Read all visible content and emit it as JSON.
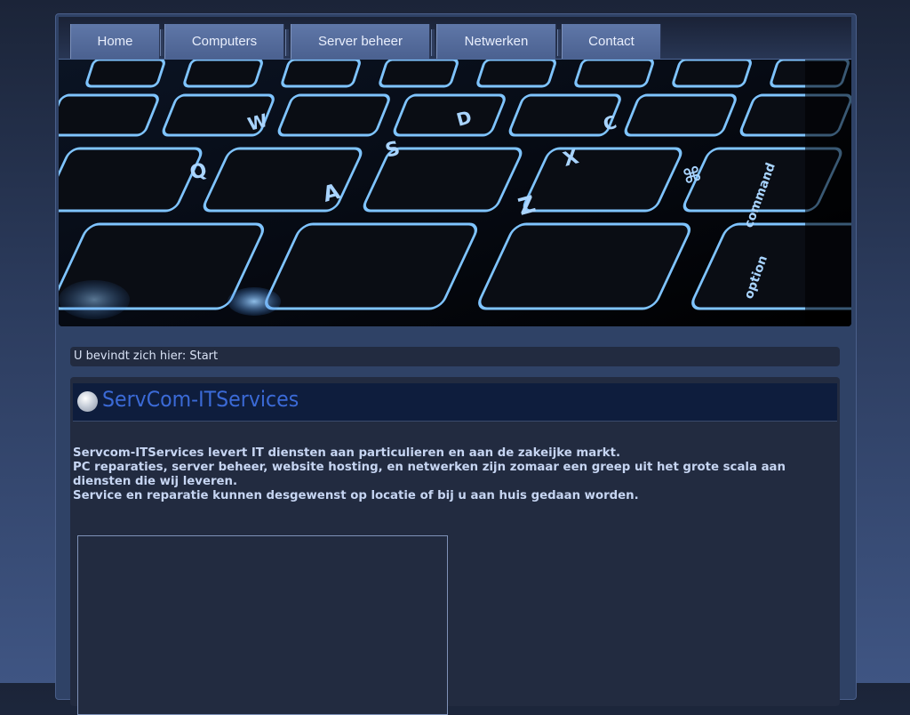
{
  "nav": {
    "items": [
      {
        "label": "Home"
      },
      {
        "label": "Computers"
      },
      {
        "label": "Server beheer"
      },
      {
        "label": "Netwerken"
      },
      {
        "label": "Contact"
      }
    ]
  },
  "banner": {
    "image": "backlit-keyboard"
  },
  "breadcrumb": {
    "text": "U bevindt zich hier: Start"
  },
  "content": {
    "title": "ServCom-ITServices",
    "paragraphs": [
      "Servcom-ITServices levert IT diensten aan particulieren en aan de zakeijke markt.",
      "PC reparaties, server beheer, website hosting, en netwerken zijn zomaar een greep uit het grote scala aan diensten die wij leveren.",
      "Service en reparatie kunnen desgewenst op locatie of bij u aan huis gedaan worden."
    ]
  },
  "colors": {
    "accent": "#3b6ad6",
    "nav": "#5a72a3",
    "panel": "#222b40"
  }
}
